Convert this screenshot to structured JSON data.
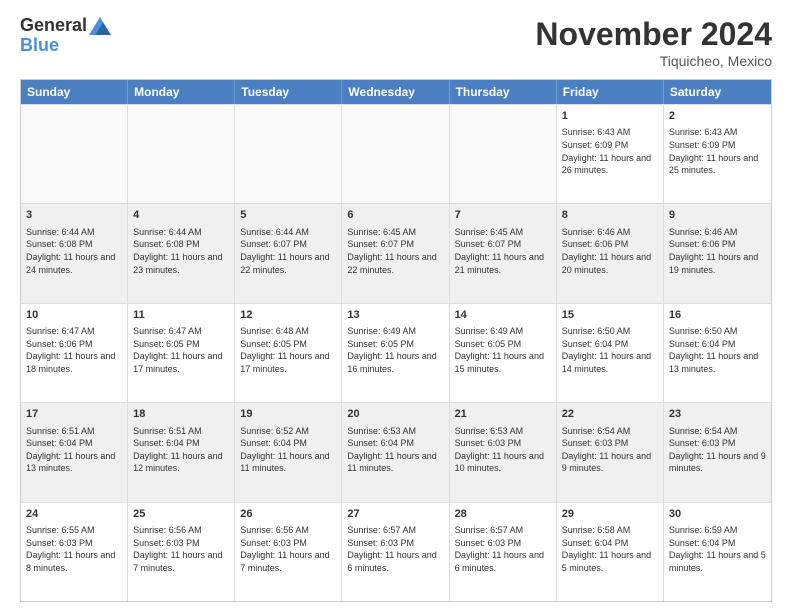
{
  "header": {
    "logo_line1": "General",
    "logo_line2": "Blue",
    "month": "November 2024",
    "location": "Tiquicheo, Mexico"
  },
  "days_of_week": [
    "Sunday",
    "Monday",
    "Tuesday",
    "Wednesday",
    "Thursday",
    "Friday",
    "Saturday"
  ],
  "rows": [
    [
      {
        "day": "",
        "info": ""
      },
      {
        "day": "",
        "info": ""
      },
      {
        "day": "",
        "info": ""
      },
      {
        "day": "",
        "info": ""
      },
      {
        "day": "",
        "info": ""
      },
      {
        "day": "1",
        "info": "Sunrise: 6:43 AM\nSunset: 6:09 PM\nDaylight: 11 hours and 26 minutes."
      },
      {
        "day": "2",
        "info": "Sunrise: 6:43 AM\nSunset: 6:09 PM\nDaylight: 11 hours and 25 minutes."
      }
    ],
    [
      {
        "day": "3",
        "info": "Sunrise: 6:44 AM\nSunset: 6:08 PM\nDaylight: 11 hours and 24 minutes."
      },
      {
        "day": "4",
        "info": "Sunrise: 6:44 AM\nSunset: 6:08 PM\nDaylight: 11 hours and 23 minutes."
      },
      {
        "day": "5",
        "info": "Sunrise: 6:44 AM\nSunset: 6:07 PM\nDaylight: 11 hours and 22 minutes."
      },
      {
        "day": "6",
        "info": "Sunrise: 6:45 AM\nSunset: 6:07 PM\nDaylight: 11 hours and 22 minutes."
      },
      {
        "day": "7",
        "info": "Sunrise: 6:45 AM\nSunset: 6:07 PM\nDaylight: 11 hours and 21 minutes."
      },
      {
        "day": "8",
        "info": "Sunrise: 6:46 AM\nSunset: 6:06 PM\nDaylight: 11 hours and 20 minutes."
      },
      {
        "day": "9",
        "info": "Sunrise: 6:46 AM\nSunset: 6:06 PM\nDaylight: 11 hours and 19 minutes."
      }
    ],
    [
      {
        "day": "10",
        "info": "Sunrise: 6:47 AM\nSunset: 6:06 PM\nDaylight: 11 hours and 18 minutes."
      },
      {
        "day": "11",
        "info": "Sunrise: 6:47 AM\nSunset: 6:05 PM\nDaylight: 11 hours and 17 minutes."
      },
      {
        "day": "12",
        "info": "Sunrise: 6:48 AM\nSunset: 6:05 PM\nDaylight: 11 hours and 17 minutes."
      },
      {
        "day": "13",
        "info": "Sunrise: 6:49 AM\nSunset: 6:05 PM\nDaylight: 11 hours and 16 minutes."
      },
      {
        "day": "14",
        "info": "Sunrise: 6:49 AM\nSunset: 6:05 PM\nDaylight: 11 hours and 15 minutes."
      },
      {
        "day": "15",
        "info": "Sunrise: 6:50 AM\nSunset: 6:04 PM\nDaylight: 11 hours and 14 minutes."
      },
      {
        "day": "16",
        "info": "Sunrise: 6:50 AM\nSunset: 6:04 PM\nDaylight: 11 hours and 13 minutes."
      }
    ],
    [
      {
        "day": "17",
        "info": "Sunrise: 6:51 AM\nSunset: 6:04 PM\nDaylight: 11 hours and 13 minutes."
      },
      {
        "day": "18",
        "info": "Sunrise: 6:51 AM\nSunset: 6:04 PM\nDaylight: 11 hours and 12 minutes."
      },
      {
        "day": "19",
        "info": "Sunrise: 6:52 AM\nSunset: 6:04 PM\nDaylight: 11 hours and 11 minutes."
      },
      {
        "day": "20",
        "info": "Sunrise: 6:53 AM\nSunset: 6:04 PM\nDaylight: 11 hours and 11 minutes."
      },
      {
        "day": "21",
        "info": "Sunrise: 6:53 AM\nSunset: 6:03 PM\nDaylight: 11 hours and 10 minutes."
      },
      {
        "day": "22",
        "info": "Sunrise: 6:54 AM\nSunset: 6:03 PM\nDaylight: 11 hours and 9 minutes."
      },
      {
        "day": "23",
        "info": "Sunrise: 6:54 AM\nSunset: 6:03 PM\nDaylight: 11 hours and 9 minutes."
      }
    ],
    [
      {
        "day": "24",
        "info": "Sunrise: 6:55 AM\nSunset: 6:03 PM\nDaylight: 11 hours and 8 minutes."
      },
      {
        "day": "25",
        "info": "Sunrise: 6:56 AM\nSunset: 6:03 PM\nDaylight: 11 hours and 7 minutes."
      },
      {
        "day": "26",
        "info": "Sunrise: 6:56 AM\nSunset: 6:03 PM\nDaylight: 11 hours and 7 minutes."
      },
      {
        "day": "27",
        "info": "Sunrise: 6:57 AM\nSunset: 6:03 PM\nDaylight: 11 hours and 6 minutes."
      },
      {
        "day": "28",
        "info": "Sunrise: 6:57 AM\nSunset: 6:03 PM\nDaylight: 11 hours and 6 minutes."
      },
      {
        "day": "29",
        "info": "Sunrise: 6:58 AM\nSunset: 6:04 PM\nDaylight: 11 hours and 5 minutes."
      },
      {
        "day": "30",
        "info": "Sunrise: 6:59 AM\nSunset: 6:04 PM\nDaylight: 11 hours and 5 minutes."
      }
    ]
  ]
}
